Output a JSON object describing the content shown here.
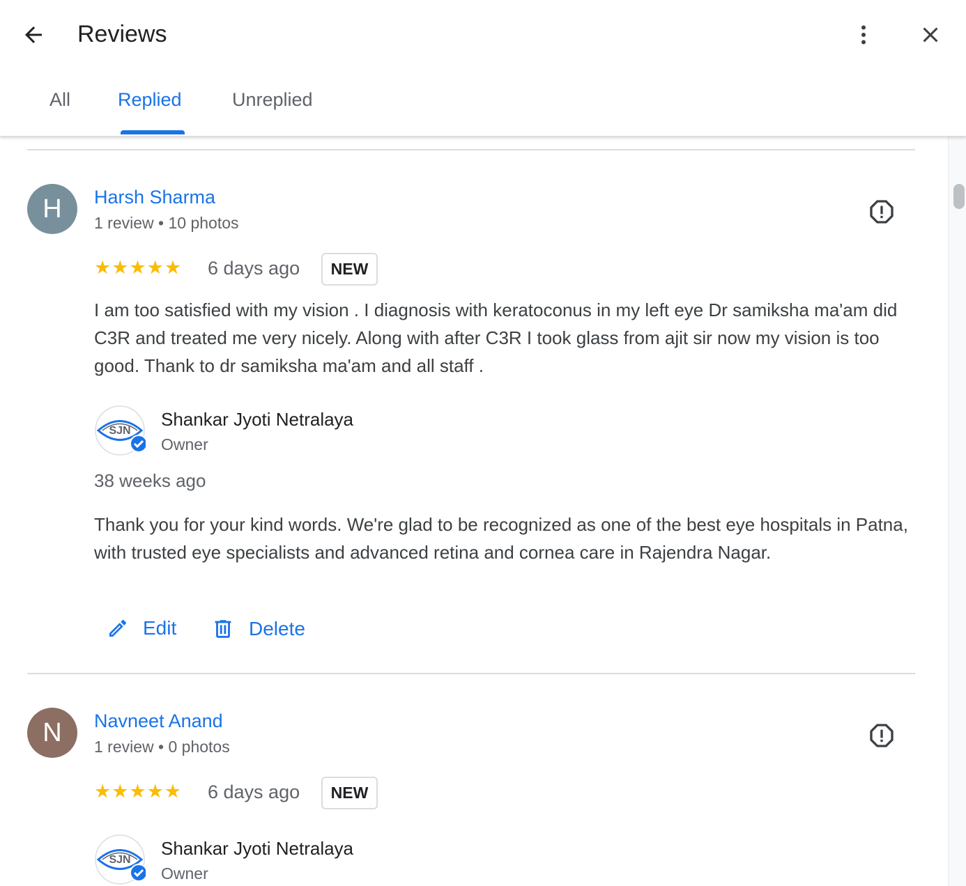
{
  "header": {
    "title": "Reviews",
    "back_icon": "arrow-back-icon",
    "more_icon": "more-vert-icon",
    "close_icon": "close-icon"
  },
  "tabs": [
    {
      "label": "All",
      "active": false
    },
    {
      "label": "Replied",
      "active": true
    },
    {
      "label": "Unreplied",
      "active": false
    }
  ],
  "colors": {
    "accent": "#1a73e8",
    "star": "#fbbc04",
    "avatar_h": "#78909c",
    "avatar_n": "#8d6e63",
    "verified": "#1a73e8"
  },
  "reviews": [
    {
      "avatar_letter": "H",
      "name": "Harsh Sharma",
      "meta": "1 review • 10 photos",
      "rating": 5,
      "stars": "★★★★★",
      "date": "6 days ago",
      "badge": "NEW",
      "text": "I am too satisfied with my vision . I diagnosis with keratoconus in my left eye Dr samiksha ma'am did C3R and treated me very nicely. Along with after C3R I took glass from ajit sir now my vision is too good. Thank to dr samiksha ma'am and all staff .",
      "reply": {
        "owner_name": "Shankar Jyoti Netralaya",
        "owner_role": "Owner",
        "logo_text": "SJN",
        "date": "38 weeks ago",
        "text": "Thank you for your kind words. We're glad to be recognized as one of the best eye hospitals in Patna, with trusted eye specialists and advanced retina and cornea care in Rajendra Nagar."
      },
      "actions": {
        "edit": "Edit",
        "delete": "Delete"
      }
    },
    {
      "avatar_letter": "N",
      "name": "Navneet Anand",
      "meta": "1 review • 0 photos",
      "rating": 5,
      "stars": "★★★★★",
      "date": "6 days ago",
      "badge": "NEW",
      "reply": {
        "owner_name": "Shankar Jyoti Netralaya",
        "owner_role": "Owner",
        "logo_text": "SJN"
      }
    }
  ]
}
